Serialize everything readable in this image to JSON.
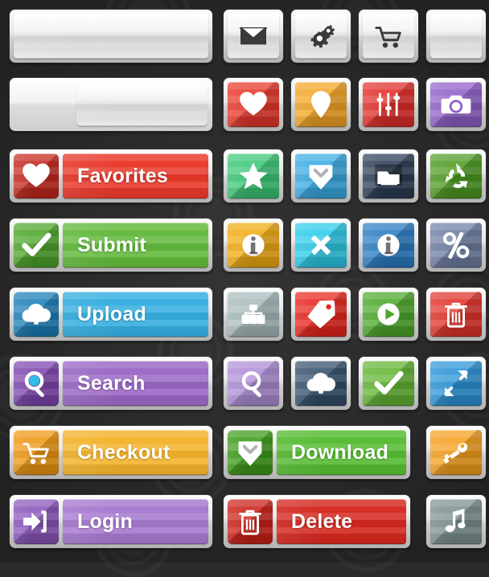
{
  "kit": {
    "title": "Flat UI Button Set",
    "background_color": "#2b2b2b",
    "chrome_color": "#e9e9e9"
  },
  "rows": [
    {
      "row": 1,
      "wide": {
        "name": "blank-bar",
        "label": "",
        "color": "#e6e6e6",
        "icon": "none",
        "style": "silver"
      },
      "icons": [
        {
          "name": "envelope-icon",
          "icon": "envelope",
          "color": "#e8e8e8",
          "icon_color": "#3a3a3a"
        },
        {
          "name": "settings-gears-icon",
          "icon": "gears",
          "color": "#e8e8e8",
          "icon_color": "#3a3a3a"
        },
        {
          "name": "shopping-cart-icon",
          "icon": "cart",
          "color": "#e8e8e8",
          "icon_color": "#3a3a3a"
        },
        {
          "name": "blank-square",
          "icon": "none",
          "color": "#e8e8e8",
          "icon_color": "#3a3a3a"
        }
      ]
    },
    {
      "row": 2,
      "wide": {
        "name": "slider-bar",
        "label": "",
        "color": "#e6e6e6",
        "icon": "none",
        "style": "slider"
      },
      "icons": [
        {
          "name": "heart-icon",
          "icon": "heart",
          "color": "#e8372a",
          "icon_color": "#ffffff"
        },
        {
          "name": "map-pin-icon",
          "icon": "pin",
          "color": "#f4a524",
          "icon_color": "#ffffff"
        },
        {
          "name": "equalizer-icon",
          "icon": "sliders",
          "color": "#e12f2a",
          "icon_color": "#ffffff"
        },
        {
          "name": "camera-icon",
          "icon": "camera",
          "color": "#9160c8",
          "icon_color": "#ffffff"
        }
      ]
    },
    {
      "row": 3,
      "wide": {
        "name": "favorites-button",
        "label": "Favorites",
        "color": "#e8382a",
        "pad_color": "#c5281d",
        "icon": "heart"
      },
      "icons": [
        {
          "name": "star-icon",
          "icon": "star",
          "color": "#3cc777",
          "icon_color": "#ffffff"
        },
        {
          "name": "download-badge-icon",
          "icon": "downloadbadge",
          "color": "#3aabe4",
          "icon_color": "#ffffff"
        },
        {
          "name": "folder-icon",
          "icon": "folder",
          "color": "#2b3d56",
          "icon_color": "#ffffff"
        },
        {
          "name": "recycle-refresh-icon",
          "icon": "recycle",
          "color": "#4e9b22",
          "icon_color": "#ffffff"
        }
      ]
    },
    {
      "row": 4,
      "wide": {
        "name": "submit-button",
        "label": "Submit",
        "color": "#62b93c",
        "pad_color": "#4da52a",
        "icon": "check"
      },
      "icons": [
        {
          "name": "info-amber-icon",
          "icon": "info",
          "color": "#f0ab12",
          "icon_color": "#ffffff"
        },
        {
          "name": "close-x-icon",
          "icon": "cross",
          "color": "#2bcbe8",
          "icon_color": "#ffffff"
        },
        {
          "name": "info-blue-icon",
          "icon": "info",
          "color": "#2a7cc4",
          "icon_color": "#ffffff"
        },
        {
          "name": "percent-icon",
          "icon": "percent",
          "color": "#6f7fa3",
          "icon_color": "#ffffff"
        }
      ]
    },
    {
      "row": 5,
      "wide": {
        "name": "upload-button",
        "label": "Upload",
        "color": "#35aee0",
        "pad_color": "#1b7fb8",
        "icon": "cloudup"
      },
      "icons": [
        {
          "name": "server-rack-icon",
          "icon": "server",
          "color": "#a9bcbd",
          "icon_color": "#ffffff"
        },
        {
          "name": "price-tag-icon",
          "icon": "tag",
          "color": "#e8261d",
          "icon_color": "#ffffff"
        },
        {
          "name": "play-icon",
          "icon": "play",
          "color": "#4da82a",
          "icon_color": "#ffffff"
        },
        {
          "name": "trash-icon",
          "icon": "trash",
          "color": "#e1342b",
          "icon_color": "#ffffff"
        }
      ]
    },
    {
      "row": 6,
      "wide": {
        "name": "search-button",
        "label": "Search",
        "color": "#9a68c5",
        "pad_color": "#7e46b0",
        "icon": "magnifier"
      },
      "icons": [
        {
          "name": "magnifier-icon",
          "icon": "magnifier2",
          "color": "#ae8ed6",
          "icon_color": "#ffffff"
        },
        {
          "name": "cloud-upload-icon",
          "icon": "cloudup",
          "color": "#35506c",
          "icon_color": "#ffffff"
        },
        {
          "name": "check-icon",
          "icon": "check",
          "color": "#63b534",
          "icon_color": "#ffffff"
        },
        {
          "name": "expand-arrows-icon",
          "icon": "expand",
          "color": "#2b95d8",
          "icon_color": "#ffffff"
        }
      ]
    },
    {
      "row": 7,
      "wide": {
        "name": "checkout-button",
        "label": "Checkout",
        "color": "#f3b32b",
        "pad_color": "#ef9712",
        "icon": "cart"
      },
      "wide2": {
        "name": "download-button",
        "label": "Download",
        "color": "#55bb32",
        "pad_color": "#3d9b19",
        "icon": "downloadbadge"
      },
      "icons": [
        {
          "name": "key-icon",
          "icon": "key",
          "color": "#f5a01e",
          "icon_color": "#ffffff"
        }
      ]
    },
    {
      "row": 8,
      "wide": {
        "name": "login-button",
        "label": "Login",
        "color": "#a678cf",
        "pad_color": "#8a55bb",
        "icon": "login"
      },
      "wide2": {
        "name": "delete-button",
        "label": "Delete",
        "color": "#d4281f",
        "pad_color": "#cc2118",
        "icon": "trash"
      },
      "icons": [
        {
          "name": "music-note-icon",
          "icon": "music",
          "color": "#7d9191",
          "icon_color": "#ffffff"
        }
      ]
    }
  ]
}
